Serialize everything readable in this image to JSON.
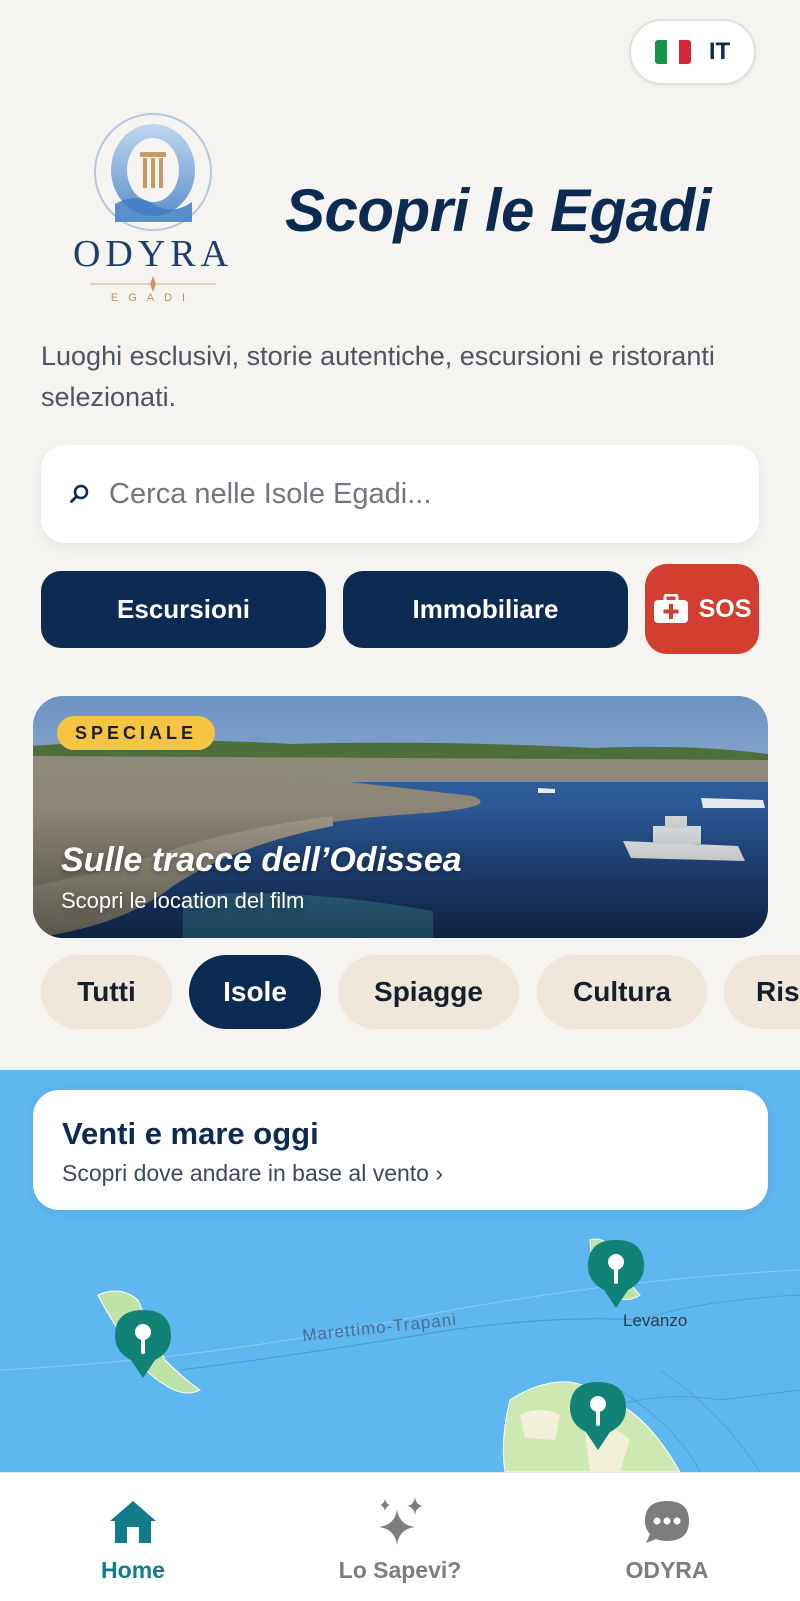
{
  "language": {
    "code": "IT",
    "flag_icon": "italy-flag-icon"
  },
  "brand": {
    "name": "ODYRA",
    "sub": "EGADI"
  },
  "header": {
    "title": "Scopri le Egadi",
    "subtitle": "Luoghi esclusivi, storie autentiche, escursioni e ristoranti selezionati."
  },
  "search": {
    "placeholder": "Cerca nelle Isole Egadi...",
    "icon": "search-icon"
  },
  "actions": {
    "excursions": "Escursioni",
    "real_estate": "Immobiliare",
    "sos": "SOS"
  },
  "banner": {
    "badge": "SPECIALE",
    "title": "Sulle tracce dell’Odissea",
    "subtitle": "Scopri le location del film"
  },
  "categories": [
    {
      "label": "Tutti",
      "active": false
    },
    {
      "label": "Isole",
      "active": true
    },
    {
      "label": "Spiagge",
      "active": false
    },
    {
      "label": "Cultura",
      "active": false
    },
    {
      "label": "Ris",
      "active": false
    }
  ],
  "map": {
    "card_title": "Venti e mare oggi",
    "card_subtitle": "Scopri dove andare in base al vento ›",
    "route_label": "Marettimo-Trapani",
    "place_label": "Levanzo"
  },
  "tabs": [
    {
      "label": "Home",
      "icon": "home-icon",
      "active": true
    },
    {
      "label": "Lo Sapevi?",
      "icon": "sparkles-icon",
      "active": false
    },
    {
      "label": "ODYRA",
      "icon": "chat-bubble-icon",
      "active": false
    }
  ],
  "colors": {
    "navy": "#0c2b52",
    "teal": "#127c8a",
    "sos_red": "#d23e2f",
    "badge_yellow": "#f5c443"
  }
}
